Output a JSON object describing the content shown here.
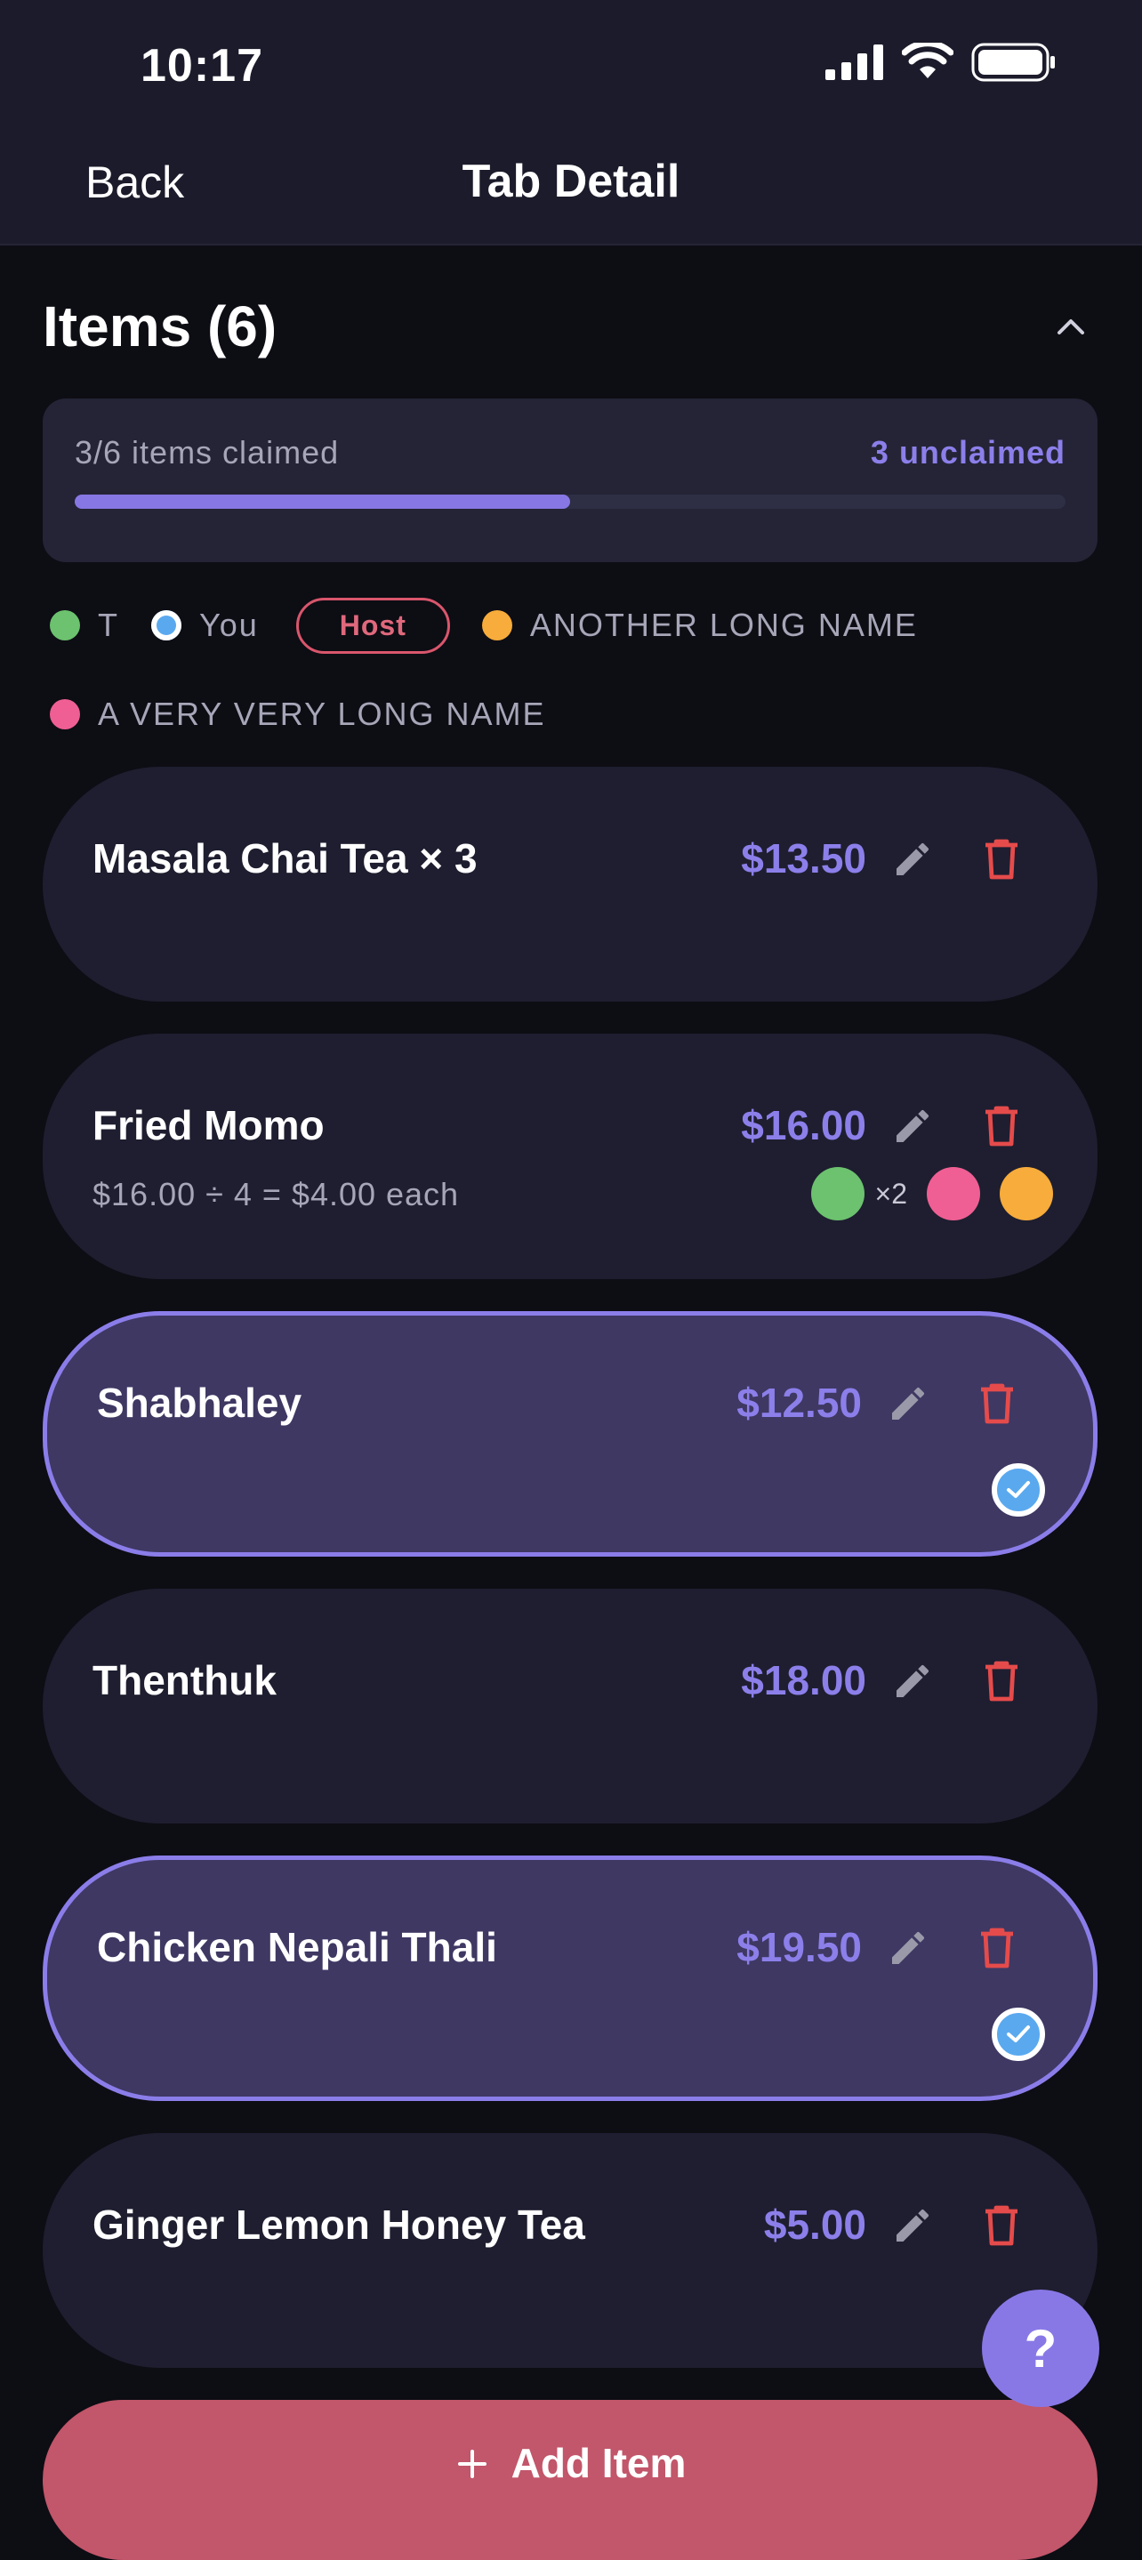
{
  "status_bar": {
    "time": "10:17"
  },
  "nav": {
    "back_label": "Back",
    "title": "Tab Detail"
  },
  "items_section": {
    "title": "Items (6)"
  },
  "progress": {
    "claimed_text": "3/6 items claimed",
    "unclaimed_text": "3 unclaimed",
    "fraction": 0.5
  },
  "participants": [
    {
      "name": "T",
      "color": "#6cc26e"
    },
    {
      "name": "You",
      "color": "#5aa9ef",
      "badge": "Host"
    },
    {
      "name": "ANOTHER LONG NAME",
      "color": "#f7ac3b"
    },
    {
      "name": "A VERY VERY LONG NAME",
      "color": "#ef5f93"
    }
  ],
  "items": [
    {
      "name": "Masala Chai Tea × 3",
      "price": "$13.50",
      "claimed": false
    },
    {
      "name": "Fried Momo",
      "price": "$16.00",
      "claimed": false,
      "split": "$16.00 ÷ 4 = $4.00 each",
      "claim_multiplier": "×2"
    },
    {
      "name": "Shabhaley",
      "price": "$12.50",
      "claimed": true
    },
    {
      "name": "Thenthuk",
      "price": "$18.00",
      "claimed": false
    },
    {
      "name": "Chicken Nepali Thali",
      "price": "$19.50",
      "claimed": true
    },
    {
      "name": "Ginger Lemon Honey Tea",
      "price": "$5.00",
      "claimed": false
    }
  ],
  "actions": {
    "add_item_label": "Add Item",
    "help_label": "?"
  },
  "colors": {
    "accent": "#8c7fea",
    "delete": "#e54b4b",
    "add_button": "#c2566a",
    "claimed_card": "#3e3863"
  }
}
